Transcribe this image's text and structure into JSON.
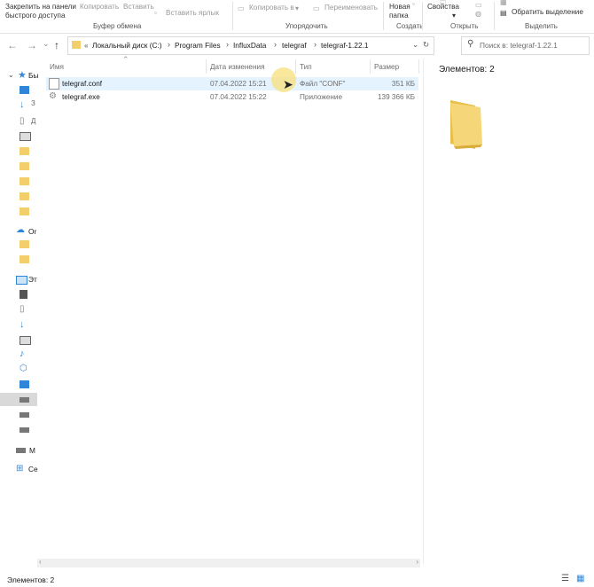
{
  "ribbon": {
    "pin_label_line1": "Закрепить на панели",
    "pin_label_line2": "быстрого доступа",
    "copy_label": "Копировать",
    "paste_label": "Вставить",
    "paste_shortcut_label": "Вставить ярлык",
    "copy_to_label": "Копировать в",
    "rename_label": "Переименовать",
    "new_folder_line1": "Новая",
    "new_folder_line2": "папка",
    "properties_label": "Свойства",
    "invert_selection_label": "Обратить выделение",
    "groups": {
      "clipboard": "Буфер обмена",
      "organize": "Упорядочить",
      "create": "Создать",
      "open": "Открыть",
      "select": "Выделить"
    }
  },
  "address": {
    "crumbs": [
      "Локальный диск (C:)",
      "Program Files",
      "InfluxData",
      "telegraf",
      "telegraf-1.22.1"
    ],
    "search_placeholder": "Поиск в: telegraf-1.22.1",
    "overflow_glyph": "«"
  },
  "nav": {
    "labels": {
      "quick_access": "Бы",
      "onedrive": "Or",
      "this_pc": "Эт",
      "network": "Се",
      "media": "M"
    }
  },
  "columns": {
    "name": "Имя",
    "date": "Дата изменения",
    "type": "Тип",
    "size": "Размер"
  },
  "files": [
    {
      "name": "telegraf.conf",
      "date": "07.04.2022 15:21",
      "type": "Файл \"CONF\"",
      "size": "351 КБ"
    },
    {
      "name": "telegraf.exe",
      "date": "07.04.2022 15:22",
      "type": "Приложение",
      "size": "139 366 КБ"
    }
  ],
  "preview": {
    "count_text": "Элементов: 2"
  },
  "status": {
    "count_text": "Элементов: 2"
  },
  "colors": {
    "folder": "#f3cf6b",
    "selection": "#e5f3ff",
    "cursor_highlight": "#f7e07a"
  }
}
